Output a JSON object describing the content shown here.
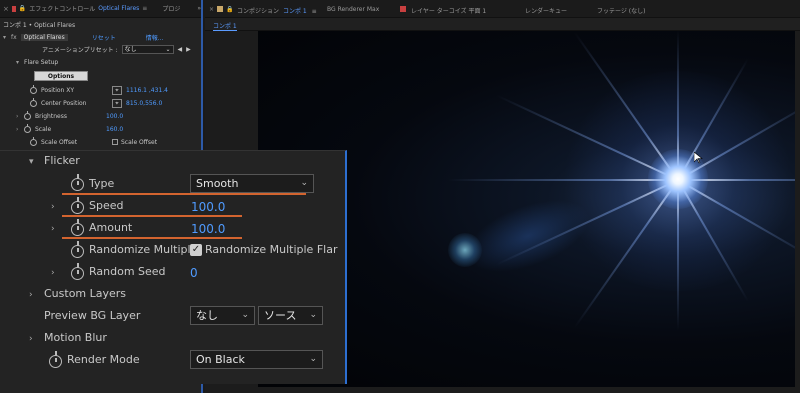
{
  "fx_panel": {
    "tab_label": "エフェクトコントロール",
    "tab_effect": "Optical Flares",
    "tab_project": "プロジ",
    "breadcrumb": "コンポ 1 • Optical Flares",
    "effect_name": "Optical Flares",
    "reset_label": "リセット",
    "about_label": "情報...",
    "preset_label": "アニメーションプリセット :",
    "preset_value": "なし",
    "flare_setup": "Flare Setup",
    "options_button": "Options",
    "position_xy_label": "Position XY",
    "position_xy_value": "1116.1 ,431.4",
    "center_position_label": "Center Position",
    "center_position_value": "815.0,556.0",
    "brightness_label": "Brightness",
    "brightness_value": "100.0",
    "scale_label": "Scale",
    "scale_value": "160.0",
    "scale_offset_label": "Scale Offset",
    "scale_offset_cb_label": "Scale Offset"
  },
  "viewer": {
    "comp_tab_prefix": "コンポジション",
    "comp_tab_name": "コンポ 1",
    "tab_bg_renderer": "BG Renderer Max",
    "tab_layer": "レイヤー ターコイズ 平面 1",
    "tab_render_queue": "レンダーキュー",
    "tab_footage": "フッテージ (なし)",
    "sub_tab": "コンポ 1"
  },
  "zoom_panel": {
    "flicker_label": "Flicker",
    "type_label": "Type",
    "type_value": "Smooth",
    "speed_label": "Speed",
    "speed_value": "100.0",
    "amount_label": "Amount",
    "amount_value": "100.0",
    "randomize_label": "Randomize Multiple",
    "randomize_cb_label": "Randomize Multiple Flar",
    "random_seed_label": "Random Seed",
    "random_seed_value": "0",
    "custom_layers_label": "Custom Layers",
    "preview_bg_label": "Preview BG Layer",
    "preview_bg_value": "なし",
    "preview_bg_source": "ソース",
    "motion_blur_label": "Motion Blur",
    "render_mode_label": "Render Mode",
    "render_mode_value": "On Black"
  },
  "colors": {
    "accent_blue": "#4f9bff",
    "underline_orange": "#d3642f",
    "panel_border_blue": "#2d6fd1"
  }
}
